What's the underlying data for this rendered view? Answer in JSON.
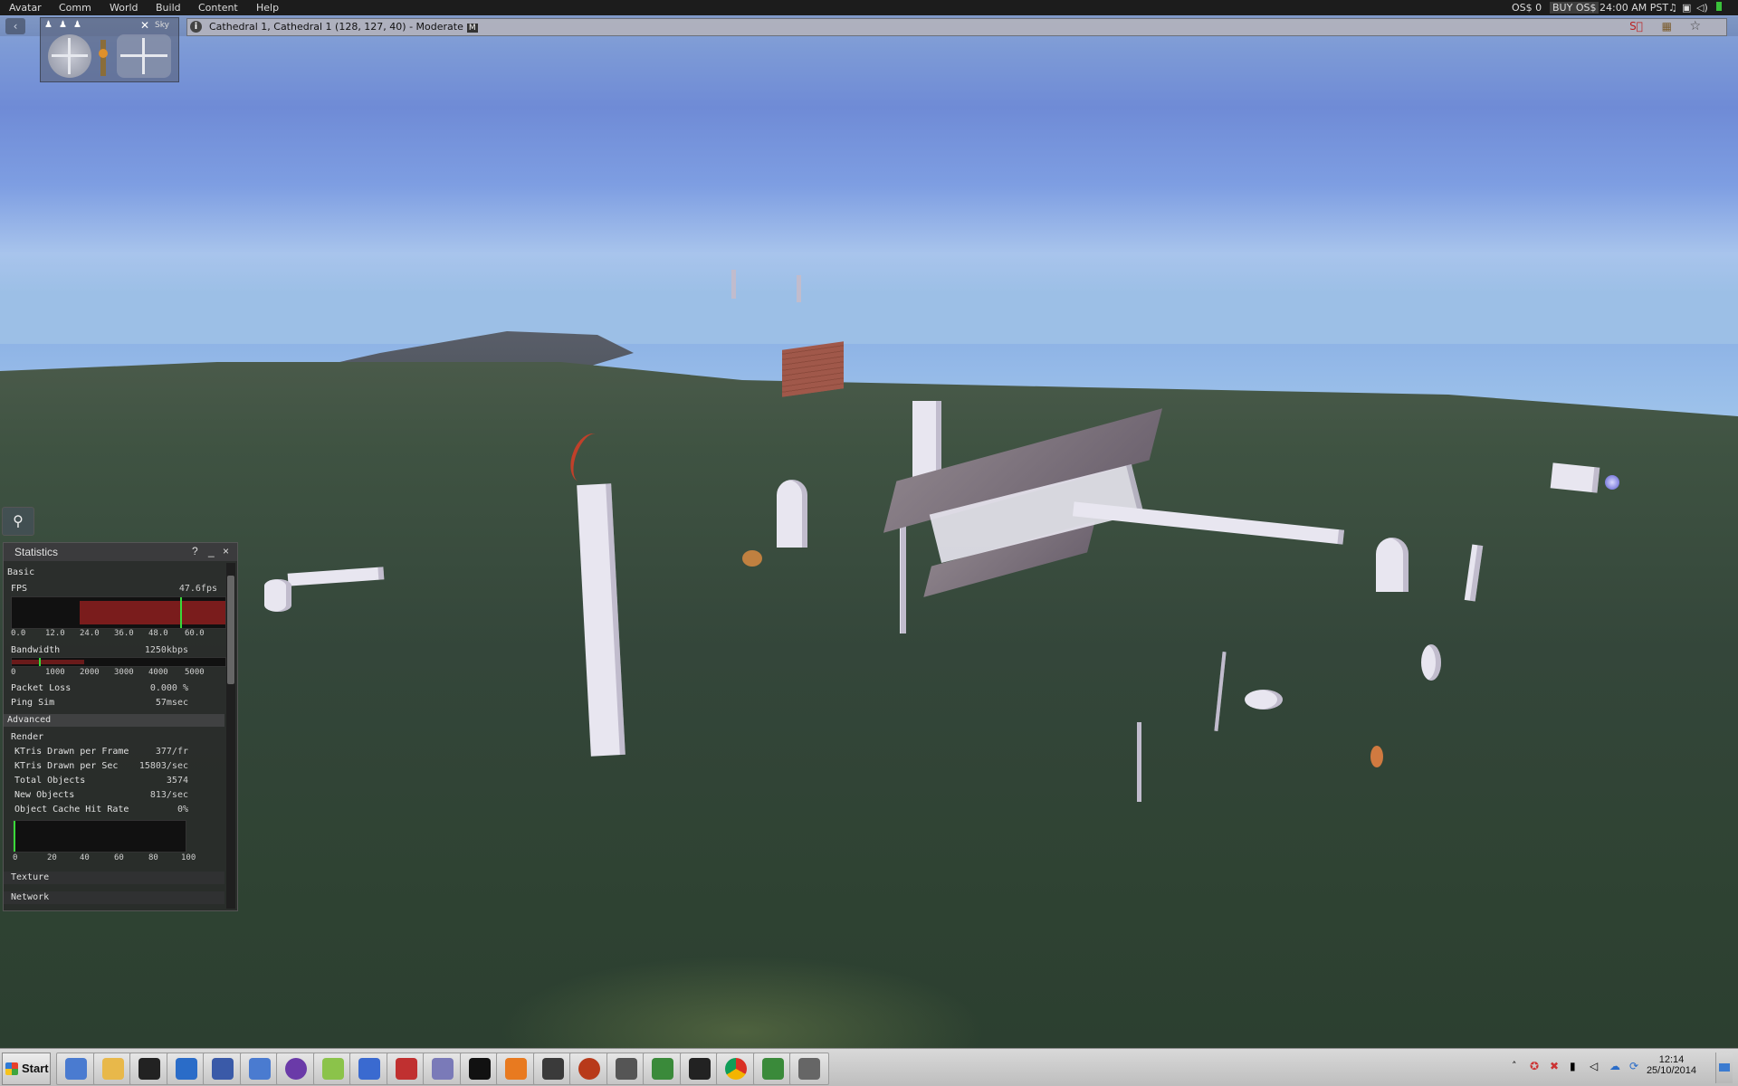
{
  "menu": {
    "items": [
      "Avatar",
      "Comm",
      "World",
      "Build",
      "Content",
      "Help"
    ],
    "balance": "OS$ 0",
    "buy": "BUY OS$",
    "time": "24:00 AM PST"
  },
  "navbar": {
    "location": "Cathedral 1, Cathedral 1 (128, 127, 40) - Moderate",
    "maturity_badge": "M"
  },
  "camera_controls": {
    "label": "Sky"
  },
  "stats": {
    "title": "Statistics",
    "help": "?",
    "minimize": "_",
    "close": "×",
    "basic_header": "Basic",
    "fps_label": "FPS",
    "fps_value": "47.6fps",
    "fps_ticks": [
      "0.0",
      "12.0",
      "24.0",
      "36.0",
      "48.0",
      "60.0"
    ],
    "fps_level": 0.79,
    "bandwidth_label": "Bandwidth",
    "bandwidth_value": "1250kbps",
    "bandwidth_ticks": [
      "0",
      "1000",
      "2000",
      "3000",
      "4000",
      "5000"
    ],
    "packet_loss_label": "Packet Loss",
    "packet_loss_value": "0.000 %",
    "ping_label": "Ping Sim",
    "ping_value": "57msec",
    "advanced_header": "Advanced",
    "render_header": "Render",
    "ktris_frame_label": "KTris Drawn per Frame",
    "ktris_frame_value": "377/fr",
    "ktris_sec_label": "KTris Drawn per Sec",
    "ktris_sec_value": "15803/sec",
    "total_objects_label": "Total Objects",
    "total_objects_value": "3574",
    "new_objects_label": "New Objects",
    "new_objects_value": "813/sec",
    "cache_label": "Object Cache Hit Rate",
    "cache_value": "0%",
    "cache_ticks": [
      "0",
      "20",
      "40",
      "60",
      "80",
      "100"
    ],
    "texture_header": "Texture",
    "network_header": "Network"
  },
  "taskbar": {
    "start": "Start",
    "icons": [
      "explorer-window-icon",
      "folder-icon",
      "blackberry-icon",
      "pycharm-icon",
      "infinity-icon",
      "window-icon",
      "eclipse-icon",
      "pen-icon",
      "network-icon",
      "mendeley-icon",
      "media-icon",
      "terminal-icon",
      "blender-icon",
      "nvidia-icon",
      "firestorm-icon",
      "inkscape-icon",
      "vim-icon",
      "clapper-icon",
      "chrome-icon",
      "gvim-icon",
      "viewer-icon"
    ],
    "clock_time": "12:14",
    "clock_date": "25/10/2014"
  }
}
